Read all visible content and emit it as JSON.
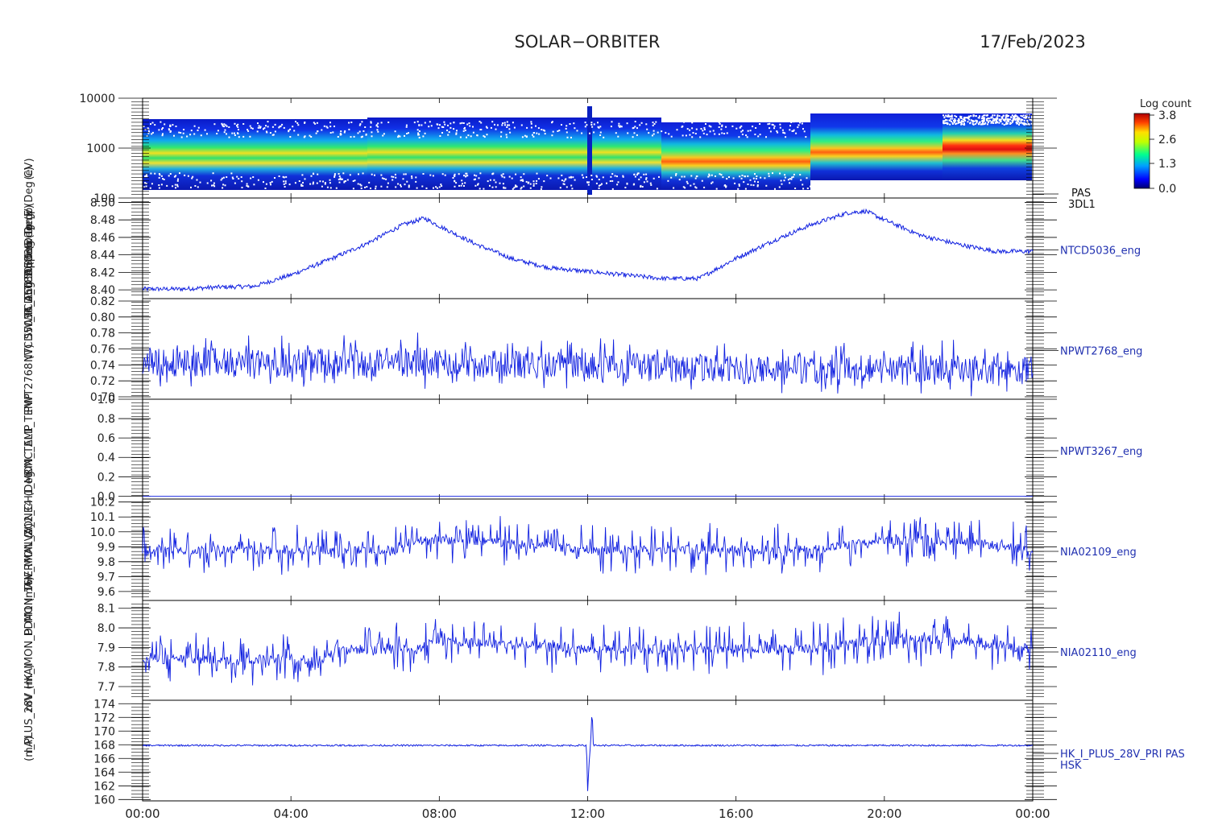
{
  "header": {
    "title": "SOLAR−ORBITER",
    "date": "17/Feb/2023"
  },
  "colorbar": {
    "title": "Log count",
    "ticks": [
      "3.8",
      "2.6",
      "1.3",
      "0.0"
    ]
  },
  "x_ticks": [
    "00:00",
    "04:00",
    "08:00",
    "12:00",
    "16:00",
    "20:00",
    "00:00"
  ],
  "y_axis_title_lines": [
    "(eV)",
    "E (Deg C)",
    "p (V)",
    "Approx Temp",
    "A_TCD5036 (Deg",
    "WA_TCD5036 (Deg",
    "SW_TCD5036 (Deg",
    "NTCD5036_eng",
    "PWT2768 (V)",
    "RMC_AL1_TEMP",
    "VA_2_CH1_MON_TEMP",
    "THERMAL_ZONE4 (Deg",
    "D_MON_16V_MON (V)",
    "mV_HK_IMON_PDM1 (mA)",
    "I_PLUS_28V (mA)",
    "(mA)"
  ],
  "chart_data": [
    {
      "type": "heatmap",
      "name": "PAS 3DL1",
      "label_lines": [
        "PAS",
        "3DL1"
      ],
      "scale": "log",
      "ylim": [
        100,
        10000
      ],
      "yticks": [
        "10000",
        "1000",
        "100"
      ],
      "colorbar_range": [
        0.0,
        3.8
      ]
    },
    {
      "type": "line",
      "name": "NTCD5036_eng",
      "ylim": [
        8.39,
        8.505
      ],
      "yticks": [
        "8.50",
        "8.48",
        "8.46",
        "8.44",
        "8.42",
        "8.40"
      ],
      "x": [
        0,
        1,
        2,
        3,
        4,
        5,
        6,
        7,
        7.6,
        8,
        9,
        10,
        11,
        12,
        13,
        14,
        15,
        16,
        17,
        18,
        19,
        19.5,
        20,
        21,
        22,
        23,
        24
      ],
      "values": [
        8.401,
        8.401,
        8.403,
        8.404,
        8.417,
        8.434,
        8.452,
        8.474,
        8.482,
        8.473,
        8.452,
        8.435,
        8.425,
        8.421,
        8.417,
        8.413,
        8.413,
        8.436,
        8.456,
        8.474,
        8.488,
        8.49,
        8.48,
        8.462,
        8.452,
        8.444,
        8.444
      ]
    },
    {
      "type": "line",
      "name": "NPWT2768_eng",
      "ylim": [
        0.697,
        0.823
      ],
      "yticks": [
        "0.82",
        "0.80",
        "0.78",
        "0.76",
        "0.74",
        "0.72",
        "0.70"
      ],
      "x": [
        0,
        4,
        8,
        12,
        16,
        20,
        24
      ],
      "values": [
        0.744,
        0.742,
        0.744,
        0.738,
        0.734,
        0.736,
        0.732
      ]
    },
    {
      "type": "line",
      "name": "NPWT3267_eng",
      "ylim": [
        -0.03,
        1.0
      ],
      "yticks": [
        "1.0",
        "0.8",
        "0.6",
        "0.4",
        "0.2",
        "0.0"
      ],
      "x": [
        0,
        24
      ],
      "values": [
        0.0,
        0.0
      ]
    },
    {
      "type": "line",
      "name": "NIA02109_eng",
      "ylim": [
        9.54,
        10.22
      ],
      "yticks": [
        "10.2",
        "10.1",
        "10.0",
        "9.9",
        "9.8",
        "9.7",
        "9.6"
      ],
      "x": [
        0,
        4,
        6.8,
        7.2,
        9,
        12,
        14.5,
        15,
        18,
        20,
        22,
        24
      ],
      "values": [
        9.88,
        9.88,
        9.88,
        9.94,
        9.94,
        9.88,
        9.88,
        9.88,
        9.88,
        9.94,
        9.94,
        9.88
      ]
    },
    {
      "type": "line",
      "name": "NIA02110_eng",
      "ylim": [
        7.63,
        8.14
      ],
      "yticks": [
        "8.1",
        "8.0",
        "7.9",
        "7.8",
        "7.7"
      ],
      "x": [
        0,
        5,
        5.2,
        7.5,
        7.7,
        12,
        15,
        18,
        20,
        22,
        24
      ],
      "values": [
        7.84,
        7.84,
        7.89,
        7.89,
        7.94,
        7.89,
        7.89,
        7.89,
        7.94,
        7.94,
        7.89
      ]
    },
    {
      "type": "line",
      "name": "HK_I_PLUS_28V_PRI PAS HSK",
      "label_lines": [
        "HK_I_PLUS_28V_PRI PAS",
        "HSK"
      ],
      "ylim": [
        159.8,
        174.5
      ],
      "yticks": [
        "174",
        "172",
        "170",
        "168",
        "166",
        "164",
        "162",
        "160"
      ],
      "x": [
        0,
        11.97,
        12.0,
        12.04,
        12.08,
        12.12,
        12.15,
        12.2,
        24
      ],
      "values": [
        167.9,
        167.9,
        161.2,
        165.5,
        168.2,
        173.6,
        168.0,
        167.9,
        167.9
      ]
    }
  ]
}
